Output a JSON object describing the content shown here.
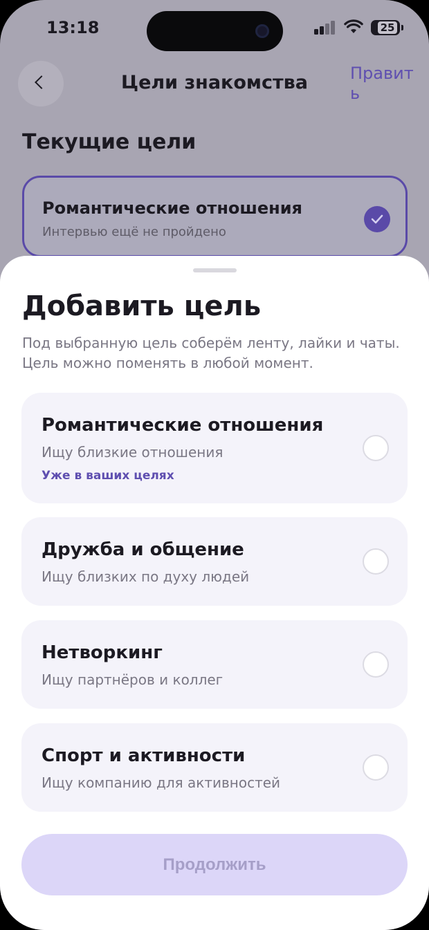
{
  "status_bar": {
    "time": "13:18",
    "battery": "25",
    "icons": [
      "signal-icon",
      "wifi-icon",
      "battery-icon"
    ]
  },
  "nav": {
    "back_icon": "chevron-left-icon",
    "title": "Цели знакомства",
    "edit_label": "Править"
  },
  "current_goals": {
    "title": "Текущие цели",
    "items": [
      {
        "title": "Романтические отношения",
        "subtitle": "Интервью ещё не пройдено",
        "selected": true
      }
    ]
  },
  "sheet": {
    "title": "Добавить цель",
    "subtitle": "Под выбранную цель соберём ленту, лайки и чаты. Цель можно поменять в любой момент.",
    "options": [
      {
        "title": "Романтические отношения",
        "subtitle": "Ищу близкие отношения",
        "note": "Уже в ваших целях",
        "checked": false
      },
      {
        "title": "Дружба и общение",
        "subtitle": "Ищу близких по духу людей",
        "note": "",
        "checked": false
      },
      {
        "title": "Нетворкинг",
        "subtitle": "Ищу партнёров и коллег",
        "note": "",
        "checked": false
      },
      {
        "title": "Спорт и активности",
        "subtitle": "Ищу компанию для активностей",
        "note": "",
        "checked": false
      }
    ],
    "continue_label": "Продолжить"
  },
  "colors": {
    "accent": "#5f4fb0",
    "button_disabled_bg": "#dcd6f8",
    "button_disabled_text": "#a69fc8",
    "card_bg": "#f4f3fa"
  }
}
